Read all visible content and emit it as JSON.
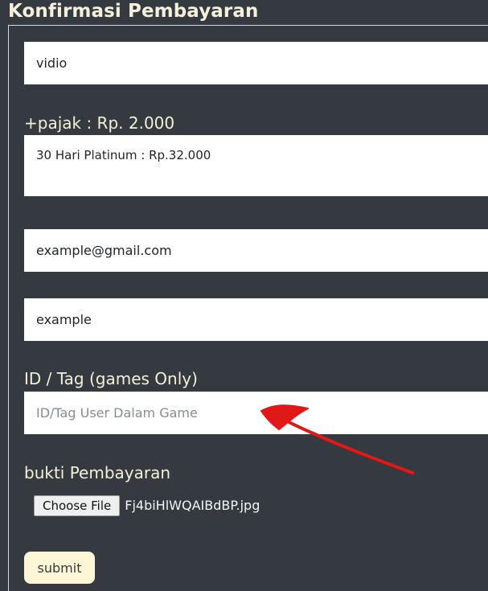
{
  "page": {
    "title": "Konfirmasi Pembayaran"
  },
  "form": {
    "service_value": "vidio",
    "tax_label": "+pajak : Rp. 2.000",
    "package_value": "30 Hari Platinum : Rp.32.000",
    "email_value": "example@gmail.com",
    "name_value": "example",
    "id_tag_label": "ID / Tag (games Only)",
    "id_tag_placeholder": "ID/Tag User Dalam Game",
    "payment_proof_label": "bukti Pembayaran",
    "file_button_label": "Choose File",
    "file_name": "Fj4biHlWQAIBdBP.jpg",
    "submit_label": "submit"
  },
  "colors": {
    "background": "#343a40",
    "field_background": "#ffffff",
    "label_text": "#f4efd7",
    "submit_background": "#fff6d8",
    "annotation": "#e01818"
  },
  "icons": {
    "annotation": "red-arrow-icon"
  }
}
